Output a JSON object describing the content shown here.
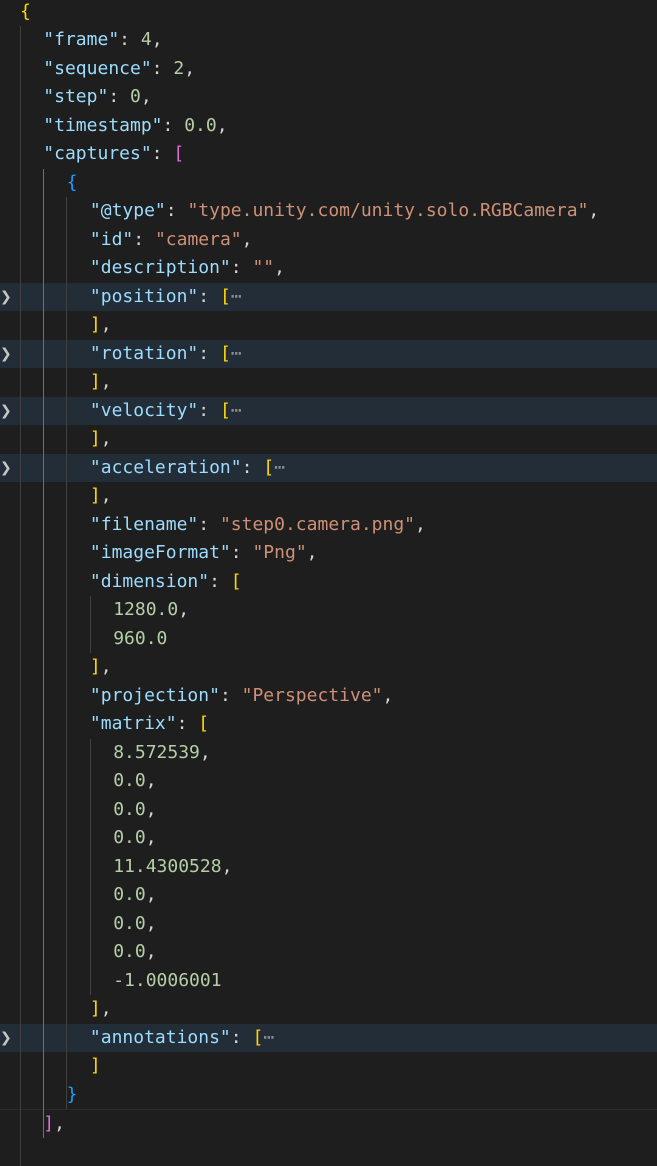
{
  "editor": {
    "lines": [
      {
        "indent": 0,
        "tokens": [
          {
            "t": "{",
            "c": "b1"
          }
        ]
      },
      {
        "indent": 1,
        "tokens": [
          {
            "t": "\"frame\"",
            "c": "k"
          },
          {
            "t": ": ",
            "c": "p"
          },
          {
            "t": "4",
            "c": "n"
          },
          {
            "t": ",",
            "c": "p"
          }
        ]
      },
      {
        "indent": 1,
        "tokens": [
          {
            "t": "\"sequence\"",
            "c": "k"
          },
          {
            "t": ": ",
            "c": "p"
          },
          {
            "t": "2",
            "c": "n"
          },
          {
            "t": ",",
            "c": "p"
          }
        ]
      },
      {
        "indent": 1,
        "tokens": [
          {
            "t": "\"step\"",
            "c": "k"
          },
          {
            "t": ": ",
            "c": "p"
          },
          {
            "t": "0",
            "c": "n"
          },
          {
            "t": ",",
            "c": "p"
          }
        ]
      },
      {
        "indent": 1,
        "tokens": [
          {
            "t": "\"timestamp\"",
            "c": "k"
          },
          {
            "t": ": ",
            "c": "p"
          },
          {
            "t": "0.0",
            "c": "n"
          },
          {
            "t": ",",
            "c": "p"
          }
        ]
      },
      {
        "indent": 1,
        "tokens": [
          {
            "t": "\"captures\"",
            "c": "k"
          },
          {
            "t": ": ",
            "c": "p"
          },
          {
            "t": "[",
            "c": "b2"
          }
        ]
      },
      {
        "indent": 2,
        "tokens": [
          {
            "t": "{",
            "c": "b3"
          }
        ]
      },
      {
        "indent": 3,
        "tokens": [
          {
            "t": "\"@type\"",
            "c": "k"
          },
          {
            "t": ": ",
            "c": "p"
          },
          {
            "t": "\"type.unity.com/unity.solo.RGBCamera\"",
            "c": "s"
          },
          {
            "t": ",",
            "c": "p"
          }
        ]
      },
      {
        "indent": 3,
        "tokens": [
          {
            "t": "\"id\"",
            "c": "k"
          },
          {
            "t": ": ",
            "c": "p"
          },
          {
            "t": "\"camera\"",
            "c": "s"
          },
          {
            "t": ",",
            "c": "p"
          }
        ]
      },
      {
        "indent": 3,
        "tokens": [
          {
            "t": "\"description\"",
            "c": "k"
          },
          {
            "t": ": ",
            "c": "p"
          },
          {
            "t": "\"\"",
            "c": "s"
          },
          {
            "t": ",",
            "c": "p"
          }
        ]
      },
      {
        "indent": 3,
        "folded": true,
        "tokens": [
          {
            "t": "\"position\"",
            "c": "k"
          },
          {
            "t": ": ",
            "c": "p"
          },
          {
            "t": "[",
            "c": "b1"
          },
          {
            "t": "⋯",
            "c": "ellipsis"
          }
        ]
      },
      {
        "indent": 3,
        "tokens": [
          {
            "t": "]",
            "c": "b1"
          },
          {
            "t": ",",
            "c": "p"
          }
        ]
      },
      {
        "indent": 3,
        "folded": true,
        "tokens": [
          {
            "t": "\"rotation\"",
            "c": "k"
          },
          {
            "t": ": ",
            "c": "p"
          },
          {
            "t": "[",
            "c": "b1"
          },
          {
            "t": "⋯",
            "c": "ellipsis"
          }
        ]
      },
      {
        "indent": 3,
        "tokens": [
          {
            "t": "]",
            "c": "b1"
          },
          {
            "t": ",",
            "c": "p"
          }
        ]
      },
      {
        "indent": 3,
        "folded": true,
        "tokens": [
          {
            "t": "\"velocity\"",
            "c": "k"
          },
          {
            "t": ": ",
            "c": "p"
          },
          {
            "t": "[",
            "c": "b1"
          },
          {
            "t": "⋯",
            "c": "ellipsis"
          }
        ]
      },
      {
        "indent": 3,
        "tokens": [
          {
            "t": "]",
            "c": "b1"
          },
          {
            "t": ",",
            "c": "p"
          }
        ]
      },
      {
        "indent": 3,
        "folded": true,
        "tokens": [
          {
            "t": "\"acceleration\"",
            "c": "k"
          },
          {
            "t": ": ",
            "c": "p"
          },
          {
            "t": "[",
            "c": "b1"
          },
          {
            "t": "⋯",
            "c": "ellipsis"
          }
        ]
      },
      {
        "indent": 3,
        "tokens": [
          {
            "t": "]",
            "c": "b1"
          },
          {
            "t": ",",
            "c": "p"
          }
        ]
      },
      {
        "indent": 3,
        "tokens": [
          {
            "t": "\"filename\"",
            "c": "k"
          },
          {
            "t": ": ",
            "c": "p"
          },
          {
            "t": "\"step0.camera.png\"",
            "c": "s"
          },
          {
            "t": ",",
            "c": "p"
          }
        ]
      },
      {
        "indent": 3,
        "tokens": [
          {
            "t": "\"imageFormat\"",
            "c": "k"
          },
          {
            "t": ": ",
            "c": "p"
          },
          {
            "t": "\"Png\"",
            "c": "s"
          },
          {
            "t": ",",
            "c": "p"
          }
        ]
      },
      {
        "indent": 3,
        "tokens": [
          {
            "t": "\"dimension\"",
            "c": "k"
          },
          {
            "t": ": ",
            "c": "p"
          },
          {
            "t": "[",
            "c": "b1"
          }
        ]
      },
      {
        "indent": 4,
        "tokens": [
          {
            "t": "1280.0",
            "c": "n"
          },
          {
            "t": ",",
            "c": "p"
          }
        ]
      },
      {
        "indent": 4,
        "tokens": [
          {
            "t": "960.0",
            "c": "n"
          }
        ]
      },
      {
        "indent": 3,
        "tokens": [
          {
            "t": "]",
            "c": "b1"
          },
          {
            "t": ",",
            "c": "p"
          }
        ]
      },
      {
        "indent": 3,
        "tokens": [
          {
            "t": "\"projection\"",
            "c": "k"
          },
          {
            "t": ": ",
            "c": "p"
          },
          {
            "t": "\"Perspective\"",
            "c": "s"
          },
          {
            "t": ",",
            "c": "p"
          }
        ]
      },
      {
        "indent": 3,
        "tokens": [
          {
            "t": "\"matrix\"",
            "c": "k"
          },
          {
            "t": ": ",
            "c": "p"
          },
          {
            "t": "[",
            "c": "b1"
          }
        ]
      },
      {
        "indent": 4,
        "tokens": [
          {
            "t": "8.572539",
            "c": "n"
          },
          {
            "t": ",",
            "c": "p"
          }
        ]
      },
      {
        "indent": 4,
        "tokens": [
          {
            "t": "0.0",
            "c": "n"
          },
          {
            "t": ",",
            "c": "p"
          }
        ]
      },
      {
        "indent": 4,
        "tokens": [
          {
            "t": "0.0",
            "c": "n"
          },
          {
            "t": ",",
            "c": "p"
          }
        ]
      },
      {
        "indent": 4,
        "tokens": [
          {
            "t": "0.0",
            "c": "n"
          },
          {
            "t": ",",
            "c": "p"
          }
        ]
      },
      {
        "indent": 4,
        "tokens": [
          {
            "t": "11.4300528",
            "c": "n"
          },
          {
            "t": ",",
            "c": "p"
          }
        ]
      },
      {
        "indent": 4,
        "tokens": [
          {
            "t": "0.0",
            "c": "n"
          },
          {
            "t": ",",
            "c": "p"
          }
        ]
      },
      {
        "indent": 4,
        "tokens": [
          {
            "t": "0.0",
            "c": "n"
          },
          {
            "t": ",",
            "c": "p"
          }
        ]
      },
      {
        "indent": 4,
        "tokens": [
          {
            "t": "0.0",
            "c": "n"
          },
          {
            "t": ",",
            "c": "p"
          }
        ]
      },
      {
        "indent": 4,
        "tokens": [
          {
            "t": "-1.0006001",
            "c": "n"
          }
        ]
      },
      {
        "indent": 3,
        "tokens": [
          {
            "t": "]",
            "c": "b1"
          },
          {
            "t": ",",
            "c": "p"
          }
        ]
      },
      {
        "indent": 3,
        "folded": true,
        "tokens": [
          {
            "t": "\"annotations\"",
            "c": "k"
          },
          {
            "t": ": ",
            "c": "p"
          },
          {
            "t": "[",
            "c": "b1"
          },
          {
            "t": "⋯",
            "c": "ellipsis"
          }
        ]
      },
      {
        "indent": 3,
        "tokens": [
          {
            "t": "]",
            "c": "b1"
          }
        ]
      },
      {
        "indent": 2,
        "tokens": [
          {
            "t": "}",
            "c": "b3"
          }
        ]
      },
      {
        "indent": 1,
        "cursor": true,
        "tokens": [
          {
            "t": "]",
            "c": "b2"
          },
          {
            "t": ",",
            "c": "p"
          }
        ]
      }
    ]
  },
  "colors": {
    "background": "#1e1e1e",
    "key": "#9cdcfe",
    "string": "#ce9178",
    "number": "#b5cea8",
    "bracket_level1": "#ffd700",
    "bracket_level2": "#da70d6",
    "bracket_level3": "#179fff",
    "folded_line_highlight": "#232d38"
  }
}
